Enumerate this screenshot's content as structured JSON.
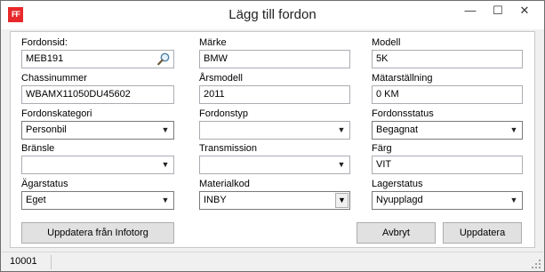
{
  "window": {
    "title": "Lägg till fordon",
    "app_icon_text": "FF",
    "minimize_glyph": "—",
    "maximize_glyph": "☐",
    "close_glyph": "✕"
  },
  "form": {
    "fordonsid": {
      "label": "Fordonsid:",
      "value": "MEB191"
    },
    "marke": {
      "label": "Märke",
      "value": "BMW"
    },
    "modell": {
      "label": "Modell",
      "value": "5K"
    },
    "chassinummer": {
      "label": "Chassinummer",
      "value": "WBAMX11050DU45602"
    },
    "arsmodell": {
      "label": "Årsmodell",
      "value": "2011"
    },
    "matarstallning": {
      "label": "Mätarställning",
      "value": "0 KM"
    },
    "fordonskategori": {
      "label": "Fordonskategori",
      "selected": "Personbil"
    },
    "fordonstyp": {
      "label": "Fordonstyp",
      "selected": ""
    },
    "fordonsstatus": {
      "label": "Fordonsstatus",
      "selected": "Begagnat"
    },
    "bransle": {
      "label": "Bränsle",
      "selected": ""
    },
    "transmission": {
      "label": "Transmission",
      "selected": ""
    },
    "farg": {
      "label": "Färg",
      "value": "VIT"
    },
    "agarstatus": {
      "label": "Ägarstatus",
      "selected": "Eget"
    },
    "materialkod": {
      "label": "Materialkod",
      "selected": "INBY"
    },
    "lagerstatus": {
      "label": "Lagerstatus",
      "selected": "Nyupplagd"
    }
  },
  "buttons": {
    "update_from_infotorg": "Uppdatera från Infotorg",
    "cancel": "Avbryt",
    "update": "Uppdatera"
  },
  "statusbar": {
    "text": "10001"
  },
  "icons": {
    "dropdown": "chevron-down-icon",
    "search": "search-icon",
    "app": "app-logo-icon"
  },
  "colors": {
    "app_icon_bg": "#e8292b"
  }
}
